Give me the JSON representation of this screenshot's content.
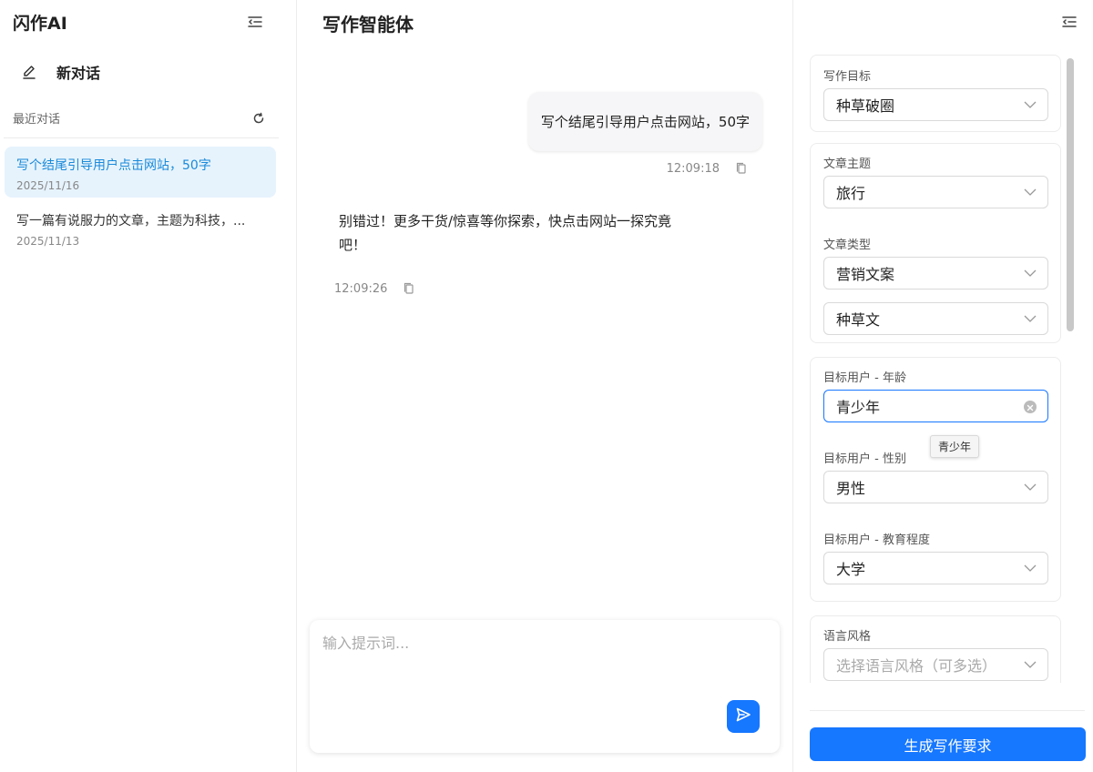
{
  "sidebar": {
    "brand": "闪作AI",
    "new_chat_label": "新对话",
    "recent_label": "最近对话",
    "conversations": [
      {
        "title": "写个结尾引导用户点击网站，50字",
        "date": "2025/11/16"
      },
      {
        "title": "写一篇有说服力的文章，主题为科技，...",
        "date": "2025/11/13"
      }
    ]
  },
  "main": {
    "title": "写作智能体",
    "user_message": "写个结尾引导用户点击网站，50字",
    "user_time": "12:09:18",
    "bot_message": "别错过！更多干货/惊喜等你探索，快点击网站一探究竟吧！",
    "bot_time": "12:09:26",
    "composer_placeholder": "输入提示词..."
  },
  "panel": {
    "writing_goal": {
      "label": "写作目标",
      "value": "种草破圈"
    },
    "article_topic": {
      "label": "文章主题",
      "value": "旅行"
    },
    "article_type": {
      "label": "文章类型",
      "value": "营销文案",
      "sub_value": "种草文"
    },
    "audience_age": {
      "label": "目标用户 - 年龄",
      "value": "青少年",
      "tooltip": "青少年"
    },
    "audience_gender": {
      "label": "目标用户 - 性别",
      "value": "男性"
    },
    "audience_education": {
      "label": "目标用户 - 教育程度",
      "value": "大学"
    },
    "language_style": {
      "label": "语言风格",
      "placeholder": "选择语言风格（可多选）"
    },
    "generate_button": "生成写作要求"
  },
  "colors": {
    "accent": "#1677ff",
    "active_item_bg": "#e6f3fd",
    "active_item_text": "#1a8ad8"
  }
}
